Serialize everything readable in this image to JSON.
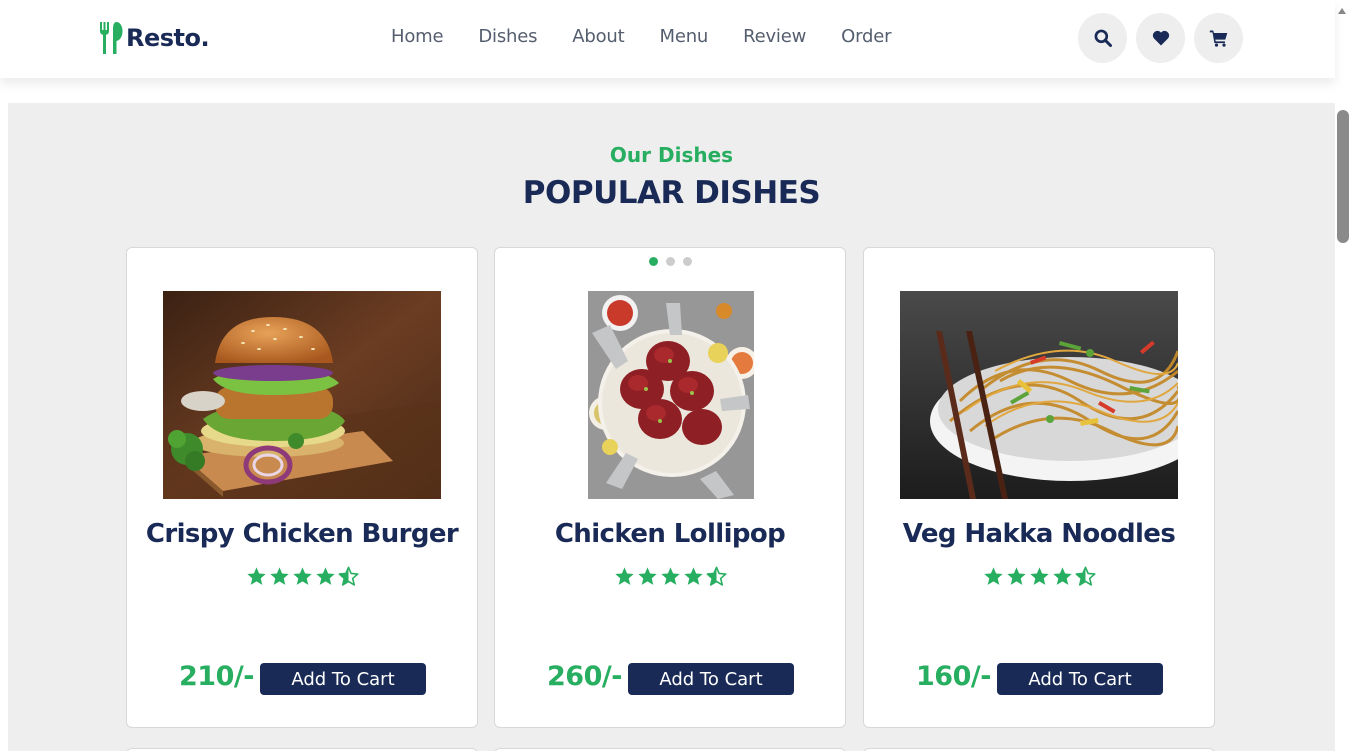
{
  "brand": {
    "name": "Resto.",
    "accent": "#27ae60",
    "dark": "#192a56"
  },
  "nav": {
    "items": [
      "Home",
      "Dishes",
      "About",
      "Menu",
      "Review",
      "Order"
    ]
  },
  "header_icons": [
    "search-icon",
    "heart-icon",
    "cart-icon"
  ],
  "section": {
    "sub_heading": "Our Dishes",
    "heading": "POPULAR DISHES"
  },
  "carousel": {
    "pages": 3,
    "active_page": 1
  },
  "dishes": [
    {
      "name": "Crispy Chicken Burger",
      "rating": 4.5,
      "price": "210/-",
      "button": "Add To Cart"
    },
    {
      "name": "Chicken Lollipop",
      "rating": 4.5,
      "price": "260/-",
      "button": "Add To Cart"
    },
    {
      "name": "Veg Hakka Noodles",
      "rating": 4.5,
      "price": "160/-",
      "button": "Add To Cart"
    }
  ]
}
